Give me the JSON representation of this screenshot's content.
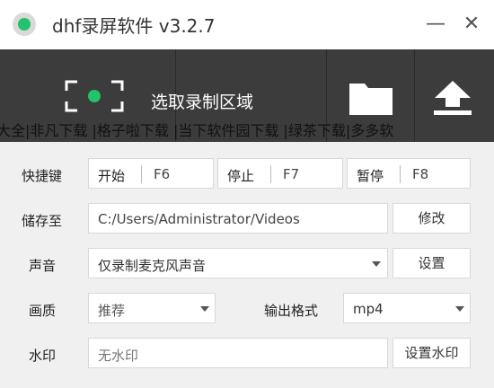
{
  "window": {
    "title": "dhf录屏软件 v3.2.7",
    "minimize_glyph": "—",
    "close_glyph": "✕"
  },
  "toolbar": {
    "region_label": "选取录制区域",
    "region_icon": "select-region-icon",
    "folder_icon": "folder-icon",
    "upload_icon": "upload-icon",
    "overlay_text": "大全|非凡下载 |格子啦下载 |当下软件园下载 |绿茶下载|多多软"
  },
  "hotkeys": {
    "label": "快捷键",
    "start_label": "开始",
    "start_key": "F6",
    "stop_label": "停止",
    "stop_key": "F7",
    "pause_label": "暂停",
    "pause_key": "F8"
  },
  "storage": {
    "label": "储存至",
    "path": "C:/Users/Administrator/Videos",
    "modify_button": "修改"
  },
  "audio": {
    "label": "声音",
    "selected": "仅录制麦克风声音",
    "settings_button": "设置"
  },
  "quality": {
    "label": "画质",
    "selected": "推荐"
  },
  "format": {
    "label": "输出格式",
    "selected": "mp4"
  },
  "watermark": {
    "label": "水印",
    "placeholder": "无水印",
    "settings_button": "设置水印"
  },
  "colors": {
    "accent_green": "#22c36a",
    "toolbar_bg": "#3c3c3c",
    "panel_bg": "#f0f0f0"
  }
}
